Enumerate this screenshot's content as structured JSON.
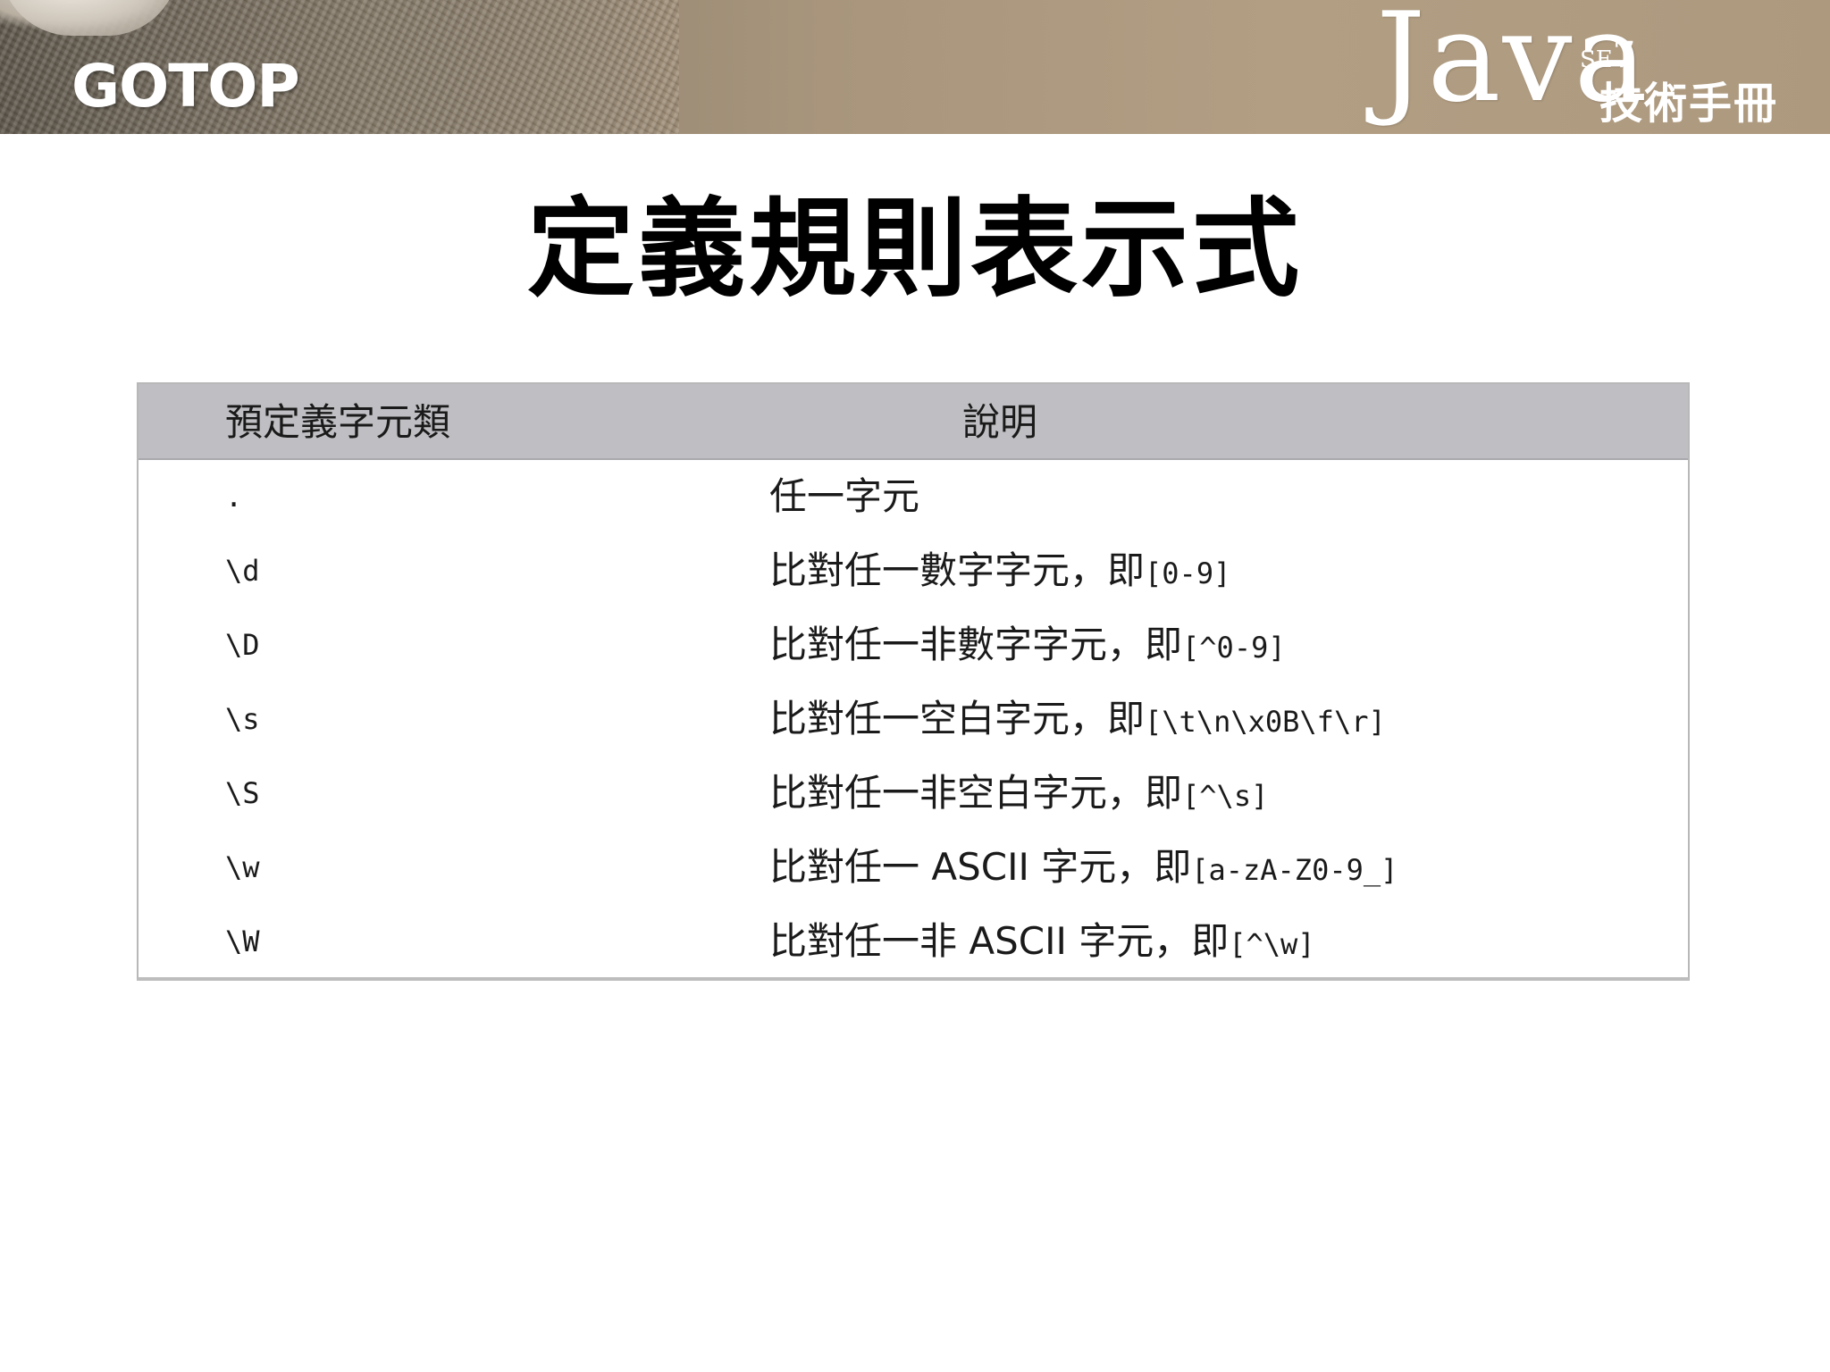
{
  "header": {
    "publisher_logo": "GOTOP",
    "book_logo": {
      "main": "Java",
      "edition_prefix": "SE",
      "edition_number": "7",
      "subtitle": "技術手冊"
    }
  },
  "slide": {
    "title": "定義規則表示式"
  },
  "table": {
    "columns": [
      "預定義字元類",
      "說明"
    ],
    "rows": [
      {
        "cls": ".",
        "desc": "任一字元",
        "pattern": ""
      },
      {
        "cls": "\\d",
        "desc": "比對任一數字字元，即",
        "pattern": "[0-9]"
      },
      {
        "cls": "\\D",
        "desc": "比對任一非數字字元，即",
        "pattern": "[^0-9]"
      },
      {
        "cls": "\\s",
        "desc": "比對任一空白字元，即",
        "pattern": "[\\t\\n\\x0B\\f\\r]"
      },
      {
        "cls": "\\S",
        "desc": "比對任一非空白字元，即",
        "pattern": "[^\\s]"
      },
      {
        "cls": "\\w",
        "desc": "比對任一 ASCII 字元，即",
        "pattern": "[a-zA-Z0-9_]"
      },
      {
        "cls": "\\W",
        "desc": "比對任一非 ASCII 字元，即",
        "pattern": "[^\\w]"
      }
    ]
  }
}
